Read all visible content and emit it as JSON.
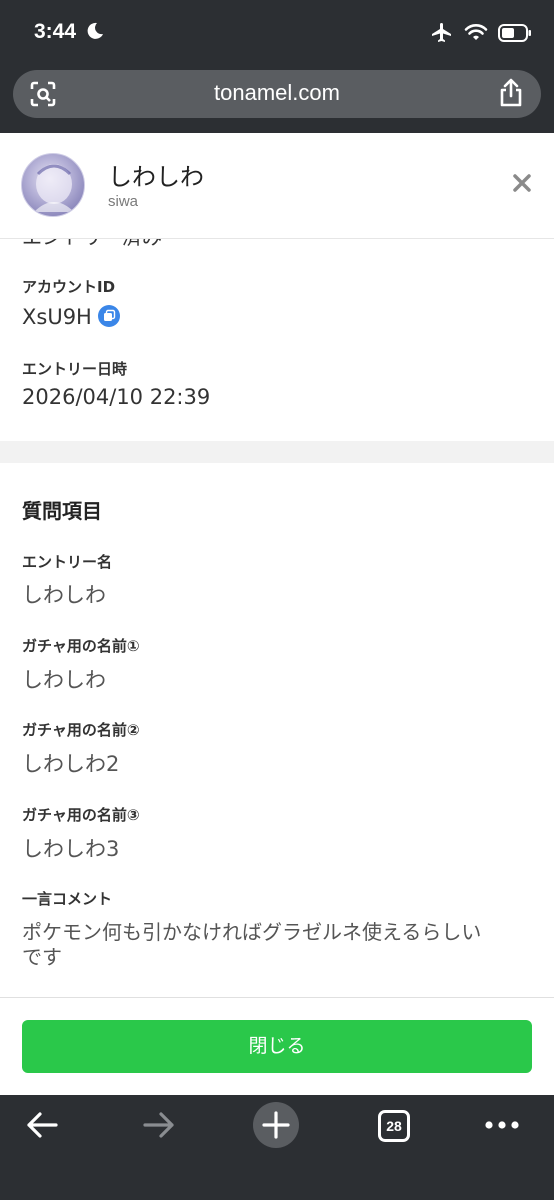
{
  "status_bar": {
    "time": "3:44"
  },
  "browser": {
    "url": "tonamel.com",
    "tab_count": "28"
  },
  "profile": {
    "name": "しわしわ",
    "handle": "siwa"
  },
  "partial_text": "エントリー済み",
  "fields": {
    "account_id_label": "アカウントID",
    "account_id_value": "XsU9H",
    "entry_time_label": "エントリー日時",
    "entry_time_value": "2026/04/10 22:39"
  },
  "questions": {
    "title": "質問項目",
    "items": [
      {
        "label": "エントリー名",
        "value": "しわしわ"
      },
      {
        "label": "ガチャ用の名前①",
        "value": "しわしわ"
      },
      {
        "label": "ガチャ用の名前②",
        "value": "しわしわ2"
      },
      {
        "label": "ガチャ用の名前③",
        "value": "しわしわ3"
      },
      {
        "label": "一言コメント",
        "value_line1": "ポケモン何も引かなければグラゼルネ使えるらしい",
        "value_line2": "です"
      }
    ]
  },
  "close_button": "閉じる",
  "colors": {
    "accent_green": "#2ac84a",
    "copy_blue": "#3a86e8",
    "chrome_dark": "#2c2f33"
  }
}
